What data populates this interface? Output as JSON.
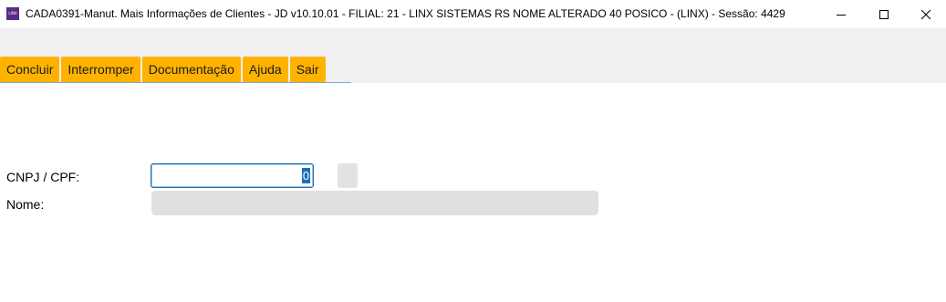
{
  "window": {
    "icon_text": "LINX",
    "title": "CADA0391-Manut. Mais Informações de Clientes - JD v10.10.01   - FILIAL: 21 - LINX SISTEMAS RS NOME ALTERADO 40 POSICO - (LINX) - Sessão: 4429",
    "controls": [
      "minimize-icon",
      "maximize-icon",
      "close-icon"
    ]
  },
  "menu": {
    "items": [
      {
        "label": "Concluir"
      },
      {
        "label": "Interromper"
      },
      {
        "label": "Documentação"
      },
      {
        "label": "Ajuda"
      },
      {
        "label": "Sair"
      }
    ],
    "color": "#ffb300"
  },
  "form": {
    "cnpj_label": "CNPJ / CPF:",
    "cnpj_value": "0",
    "name_label": "Nome:",
    "name_value": ""
  },
  "colors": {
    "accent": "#ffb300",
    "focus": "#1f6fb5",
    "disabled_field": "#e0e0e0"
  }
}
